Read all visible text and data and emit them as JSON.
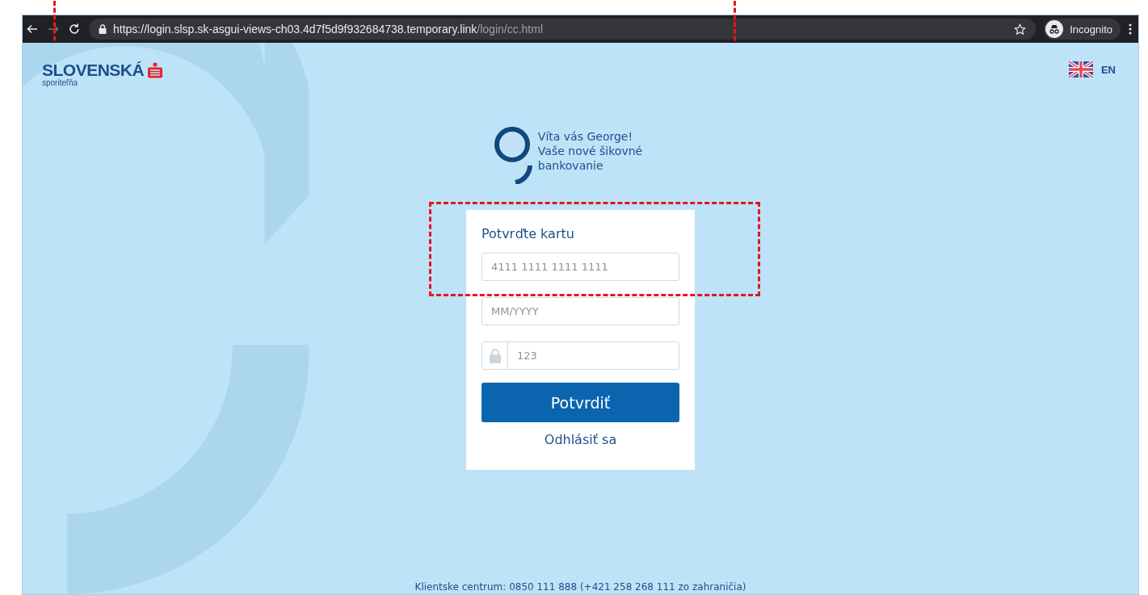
{
  "browser": {
    "url_main": "https://login.slsp.sk-asgui-views-ch03.4d7f5d9f932684738.temporary.link",
    "url_path": "/login/cc.html",
    "profile": "Incognito",
    "highlighted": true
  },
  "header": {
    "brand": "SLOVENSKÁ",
    "brand_sub": "sporiteľňa",
    "language": "EN"
  },
  "welcome": {
    "lines": [
      "Víta vás George!",
      "Vaše nové šikovné",
      "bankovanie"
    ]
  },
  "card": {
    "title": "Potvrďte kartu",
    "highlighted": true,
    "fields": [
      {
        "kind": "plain",
        "placeholder": "4111 1111 1111 1111"
      },
      {
        "kind": "plain",
        "placeholder": "MM/YYYY"
      },
      {
        "kind": "locked",
        "placeholder": "123"
      }
    ],
    "submit": "Potvrdiť",
    "logout": "Odhlásiť sa"
  },
  "footer": {
    "contact": "Klientske centrum: 0850 111 888 (+421 258 268 111 zo zahraničia)"
  }
}
